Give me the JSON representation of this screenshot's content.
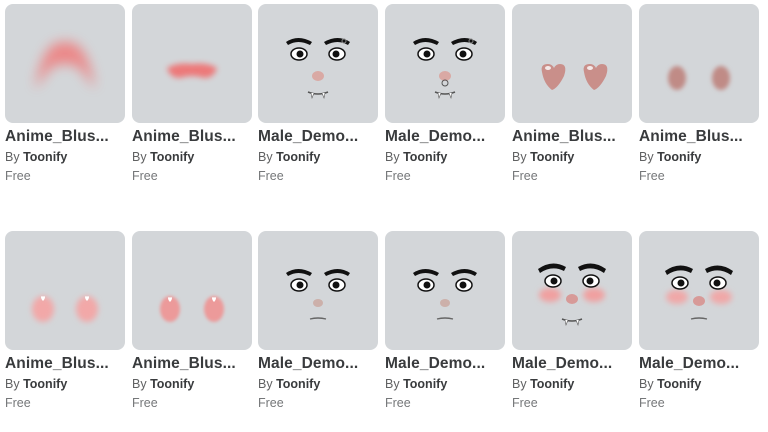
{
  "catalog": {
    "items": [
      {
        "name": "Anime_Blus...",
        "by": "By",
        "creator": "Toonify",
        "price": "Free",
        "thumb": "blush-soft-large"
      },
      {
        "name": "Anime_Blus...",
        "by": "By",
        "creator": "Toonify",
        "price": "Free",
        "thumb": "blush-stripe"
      },
      {
        "name": "Male_Demo...",
        "by": "By",
        "creator": "Toonify",
        "price": "Free",
        "thumb": "demon-face-fangs"
      },
      {
        "name": "Male_Demo...",
        "by": "By",
        "creator": "Toonify",
        "price": "Free",
        "thumb": "demon-face-fangs-ring"
      },
      {
        "name": "Anime_Blus...",
        "by": "By",
        "creator": "Toonify",
        "price": "Free",
        "thumb": "blush-hearts-dark"
      },
      {
        "name": "Anime_Blus...",
        "by": "By",
        "creator": "Toonify",
        "price": "Free",
        "thumb": "blush-ovals-dark"
      },
      {
        "name": "Anime_Blus...",
        "by": "By",
        "creator": "Toonify",
        "price": "Free",
        "thumb": "blush-hearts-pink"
      },
      {
        "name": "Anime_Blus...",
        "by": "By",
        "creator": "Toonify",
        "price": "Free",
        "thumb": "blush-hearts-bright"
      },
      {
        "name": "Male_Demo...",
        "by": "By",
        "creator": "Toonify",
        "price": "Free",
        "thumb": "demon-face-plain"
      },
      {
        "name": "Male_Demo...",
        "by": "By",
        "creator": "Toonify",
        "price": "Free",
        "thumb": "demon-face-plain-2"
      },
      {
        "name": "Male_Demo...",
        "by": "By",
        "creator": "Toonify",
        "price": "Free",
        "thumb": "demon-face-blush-fangs"
      },
      {
        "name": "Male_Demo...",
        "by": "By",
        "creator": "Toonify",
        "price": "Free",
        "thumb": "demon-face-blush"
      }
    ]
  }
}
